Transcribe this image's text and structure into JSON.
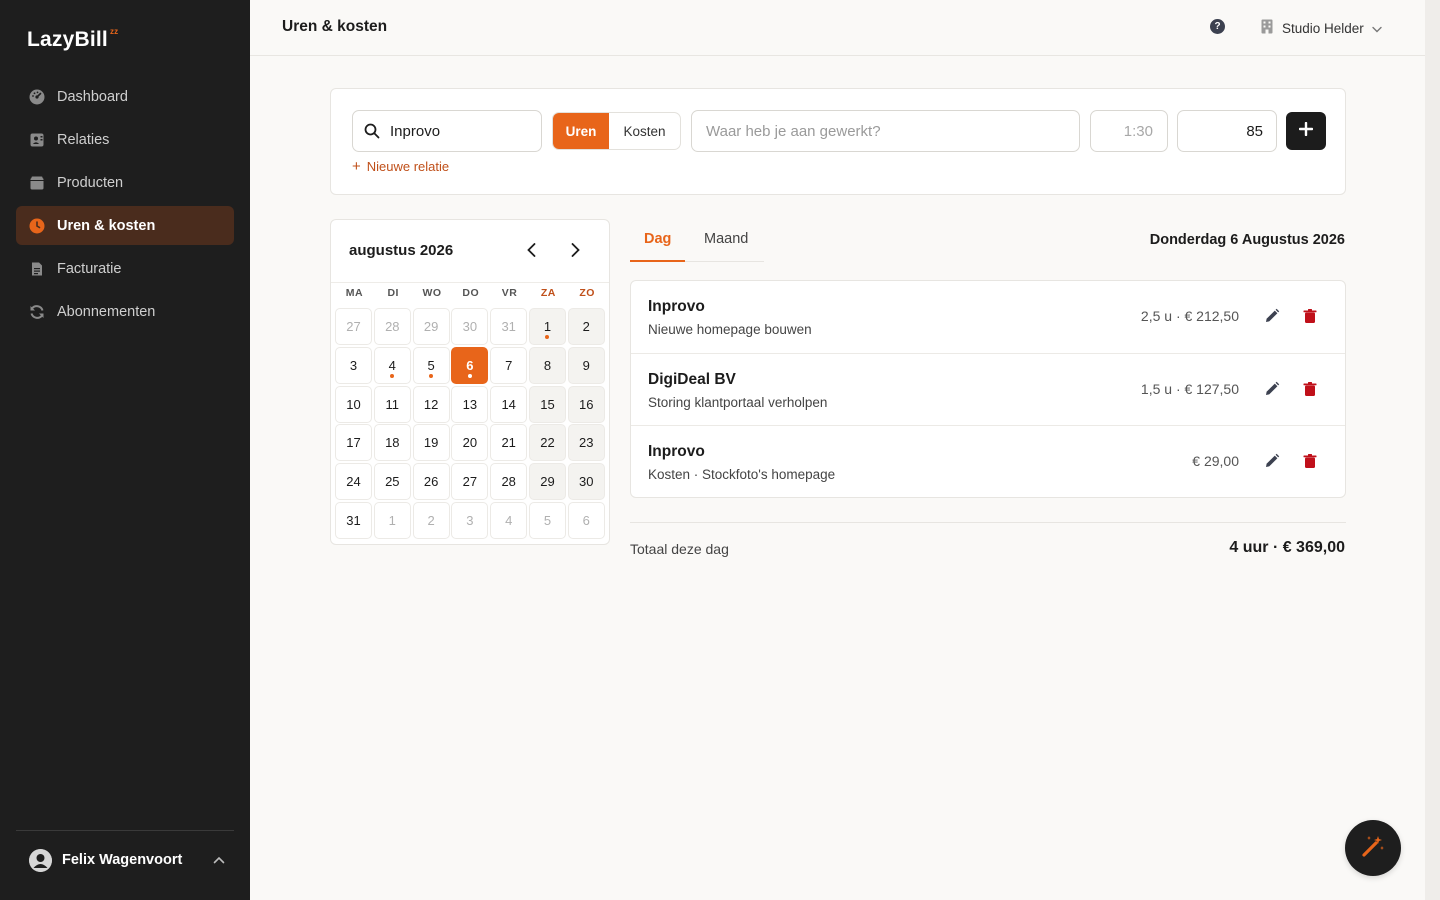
{
  "app": {
    "logo": "LazyBill",
    "logo_mark": "zz",
    "page_title": "Uren & kosten",
    "company": "Studio Helder",
    "help_icon": "?"
  },
  "sidebar": {
    "items": [
      {
        "label": "Dashboard",
        "icon": "gauge-icon"
      },
      {
        "label": "Relaties",
        "icon": "contacts-icon"
      },
      {
        "label": "Producten",
        "icon": "box-icon"
      },
      {
        "label": "Uren & kosten",
        "icon": "clock-icon",
        "active": true
      },
      {
        "label": "Facturatie",
        "icon": "invoice-icon"
      },
      {
        "label": "Abonnementen",
        "icon": "refresh-icon"
      }
    ],
    "user": "Felix Wagenvoort"
  },
  "entry": {
    "search_value": "Inprovo",
    "toggle_uren": "Uren",
    "toggle_kosten": "Kosten",
    "description_placeholder": "Waar heb je aan gewerkt?",
    "duration_placeholder": "1:30",
    "rate_value": "85",
    "new_relation": "Nieuwe relatie"
  },
  "calendar": {
    "month_label": "augustus 2026",
    "weekdays": [
      "MA",
      "DI",
      "WO",
      "DO",
      "VR",
      "ZA",
      "ZO"
    ],
    "days": [
      {
        "d": "27",
        "out": true
      },
      {
        "d": "28",
        "out": true
      },
      {
        "d": "29",
        "out": true
      },
      {
        "d": "30",
        "out": true
      },
      {
        "d": "31",
        "out": true
      },
      {
        "d": "1",
        "dot": true
      },
      {
        "d": "2"
      },
      {
        "d": "3"
      },
      {
        "d": "4",
        "dot": true
      },
      {
        "d": "5",
        "dot": true
      },
      {
        "d": "6",
        "dot": true,
        "selected": true
      },
      {
        "d": "7"
      },
      {
        "d": "8"
      },
      {
        "d": "9"
      },
      {
        "d": "10"
      },
      {
        "d": "11"
      },
      {
        "d": "12"
      },
      {
        "d": "13"
      },
      {
        "d": "14"
      },
      {
        "d": "15"
      },
      {
        "d": "16"
      },
      {
        "d": "17"
      },
      {
        "d": "18"
      },
      {
        "d": "19"
      },
      {
        "d": "20"
      },
      {
        "d": "21"
      },
      {
        "d": "22"
      },
      {
        "d": "23"
      },
      {
        "d": "24"
      },
      {
        "d": "25"
      },
      {
        "d": "26"
      },
      {
        "d": "27"
      },
      {
        "d": "28"
      },
      {
        "d": "29"
      },
      {
        "d": "30"
      },
      {
        "d": "31"
      },
      {
        "d": "1",
        "out": true
      },
      {
        "d": "2",
        "out": true
      },
      {
        "d": "3",
        "out": true
      },
      {
        "d": "4",
        "out": true
      },
      {
        "d": "5",
        "out": true
      },
      {
        "d": "6",
        "out": true
      }
    ]
  },
  "tabs": {
    "day": "Dag",
    "month": "Maand"
  },
  "date_heading": "Donderdag 6 Augustus 2026",
  "entries": [
    {
      "client": "Inprovo",
      "description": "Nieuwe homepage bouwen",
      "amount": "2,5 u · € 212,50"
    },
    {
      "client": "DigiDeal BV",
      "description": "Storing klantportaal verholpen",
      "amount": "1,5 u · € 127,50"
    },
    {
      "client": "Inprovo",
      "description": "Kosten · Stockfoto's homepage",
      "amount": "€ 29,00"
    }
  ],
  "total": {
    "label": "Totaal deze dag",
    "value": "4 uur · € 369,00"
  },
  "colors": {
    "accent": "#e8651a",
    "sidebar_bg": "#1e1e1e",
    "danger": "#c0101a"
  }
}
